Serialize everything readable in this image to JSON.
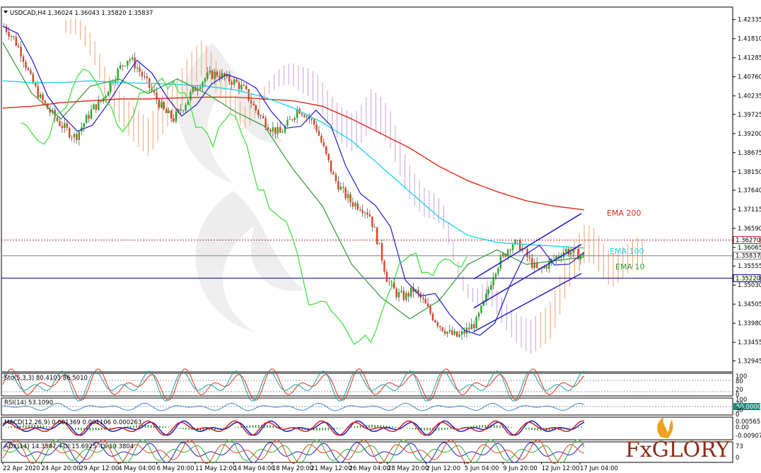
{
  "chart_data": {
    "type": "candlestick",
    "symbol_header": "USDCAD,H4  1.36024 1.36043 1.35820 1.35837",
    "x_tick_labels": [
      "22 Apr 2020",
      "24 Apr 20:00",
      "29 Apr 12:00",
      "4 May 04:00",
      "6 May 20:00",
      "11 May 12:00",
      "14 May 04:00",
      "18 May 20:00",
      "21 May 12:00",
      "26 May 04:00",
      "28 May 20:00",
      "2 Jun 12:00",
      "5 Jun 04:00",
      "9 Jun 20:00",
      "12 Jun 12:00",
      "17 Jun 04:00"
    ],
    "y_tick_labels": [
      "1.42335",
      "1.41810",
      "1.41285",
      "1.40760",
      "1.40235",
      "1.39725",
      "1.39200",
      "1.38675",
      "1.38150",
      "1.37640",
      "1.37115",
      "1.36590",
      "1.36065",
      "1.35555",
      "1.35030",
      "1.34505",
      "1.33980",
      "1.33455",
      "1.32945"
    ],
    "ylim": [
      1.3268,
      1.4264
    ],
    "price_path": [
      1.4215,
      1.4185,
      1.414,
      1.407,
      1.402,
      1.3985,
      1.3955,
      1.393,
      1.391,
      1.395,
      1.399,
      1.401,
      1.406,
      1.41,
      1.413,
      1.41,
      1.406,
      1.402,
      1.398,
      1.396,
      1.399,
      1.403,
      1.406,
      1.408,
      1.4085,
      1.407,
      1.406,
      1.404,
      1.3995,
      1.396,
      1.3935,
      1.392,
      1.395,
      1.399,
      1.397,
      1.394,
      1.387,
      1.38,
      1.376,
      1.373,
      1.372,
      1.37,
      1.362,
      1.352,
      1.348,
      1.347,
      1.349,
      1.346,
      1.342,
      1.339,
      1.337,
      1.336,
      1.338,
      1.34,
      1.346,
      1.354,
      1.358,
      1.362,
      1.361,
      1.357,
      1.354,
      1.356,
      1.358,
      1.36,
      1.359,
      1.3584
    ],
    "indicators": {
      "ema": [
        {
          "name": "EMA 200",
          "color": "#dd2a1a",
          "path": [
            1.399,
            1.3995,
            1.4005,
            1.401,
            1.4015,
            1.4015,
            1.4018,
            1.402,
            1.402,
            1.4015,
            1.401,
            1.3995,
            1.396,
            1.392,
            1.388,
            1.383,
            1.379,
            1.376,
            1.3735,
            1.372,
            1.371
          ]
        },
        {
          "name": "EMA 100",
          "color": "#22d4e8",
          "path": [
            1.4065,
            1.406,
            1.406,
            1.4065,
            1.406,
            1.4058,
            1.4055,
            1.405,
            1.404,
            1.402,
            1.399,
            1.395,
            1.39,
            1.383,
            1.376,
            1.369,
            1.364,
            1.362,
            1.3615,
            1.361,
            1.3605
          ]
        },
        {
          "name": "EMA 10",
          "color": "#2e9a2e",
          "path": [
            1.417,
            1.403,
            1.396,
            1.405,
            1.407,
            1.403,
            1.407,
            1.403,
            1.398,
            1.394,
            1.382,
            1.372,
            1.356,
            1.347,
            1.341,
            1.346,
            1.356,
            1.36,
            1.356,
            1.357,
            1.358
          ]
        }
      ]
    },
    "levels": [
      {
        "label": "1.36270",
        "value": 1.3627,
        "color": "#b22222",
        "style": "dotted"
      },
      {
        "label": "1.35837",
        "value": 1.35837,
        "color": "#808080",
        "style": "solid"
      },
      {
        "label": "1.35220",
        "value": 1.3522,
        "color": "#00008b",
        "style": "solid"
      }
    ],
    "subpanels": [
      {
        "name": "stochastic",
        "header": "Sto(5,3,3) 80.4103 86.5010",
        "scale_labels": [
          "100",
          "80",
          "20",
          "0"
        ],
        "range": [
          0,
          100
        ],
        "levels": [
          80,
          20
        ]
      },
      {
        "name": "rsi",
        "header": "RSI(14) 53.1090",
        "scale_labels": [
          "100",
          "70",
          "30",
          "0"
        ],
        "value_label": "50.0000",
        "range": [
          0,
          100
        ],
        "levels": [
          70,
          30
        ]
      },
      {
        "name": "macd",
        "header": "MACD(12,26,9) 0.001369 0.001106 0.000263",
        "scale_labels": [
          "0.00565",
          "0.00",
          "-0.009078"
        ],
        "range": [
          -0.009078,
          0.00565
        ]
      },
      {
        "name": "adx",
        "header": "ADX(14) 14.3547 +DI:15.6925 -DI:19.3804",
        "scale_labels": [
          "73",
          "0"
        ],
        "range": [
          0,
          73
        ]
      }
    ]
  },
  "annotations": {
    "ema200": "EMA 200",
    "ema100": "EMA 100",
    "ema10": "EMA 10"
  },
  "logo": {
    "text": "FxGLORY"
  },
  "colors": {
    "bull": "#22aa22",
    "bear": "#e04020",
    "kijun": "#1c1cc8",
    "chikou": "#34e034",
    "cloud_bull": "#f2a070",
    "cloud_bear": "#c8a0d8",
    "channel": "#1c1cc8"
  }
}
